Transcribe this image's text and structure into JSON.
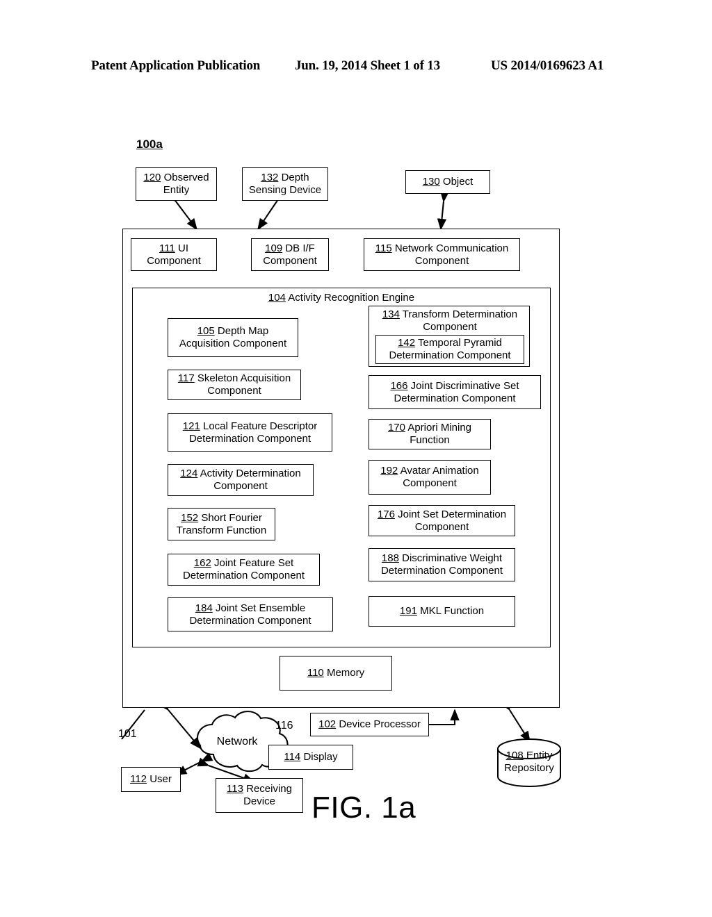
{
  "header": {
    "left": "Patent Application Publication",
    "middle": "Jun. 19, 2014  Sheet 1 of 13",
    "right": "US 2014/0169623 A1"
  },
  "figure": {
    "tag": "100a",
    "label": "FIG. 1a"
  },
  "top_boxes": [
    {
      "num": "120",
      "text": " Observed Entity"
    },
    {
      "num": "132",
      "text": " Depth Sensing Device"
    },
    {
      "num": "130",
      "text": " Object"
    }
  ],
  "interface_boxes": [
    {
      "num": "111",
      "text": " UI Component"
    },
    {
      "num": "109",
      "text": " DB I/F Component"
    },
    {
      "num": "115",
      "text": "  Network Communication Component"
    }
  ],
  "engine": {
    "num": "104",
    "title": " Activity Recognition Engine",
    "left_column": [
      {
        "num": "105",
        "text": " Depth Map Acquisition Component"
      },
      {
        "num": "117",
        "text": " Skeleton Acquisition Component"
      },
      {
        "num": "121",
        "text": " Local Feature Descriptor Determination Component"
      },
      {
        "num": "124",
        "text": " Activity Determination Component"
      },
      {
        "num": "152",
        "text": " Short Fourier Transform Function"
      },
      {
        "num": "162",
        "text": " Joint Feature Set Determination Component"
      },
      {
        "num": "184",
        "text": " Joint Set Ensemble Determination Component"
      }
    ],
    "right_column": [
      {
        "num": "134",
        "text": " Transform Determination Component",
        "nested": {
          "num": "142",
          "text": " Temporal Pyramid Determination Component"
        }
      },
      {
        "num": "166",
        "text": " Joint Discriminative Set Determination Component"
      },
      {
        "num": "170",
        "text": " Apriori Mining Function"
      },
      {
        "num": "192",
        "text": " Avatar Animation Component"
      },
      {
        "num": "176",
        "text": " Joint Set Determination Component"
      },
      {
        "num": "188",
        "text": " Discriminative Weight Determination Component"
      },
      {
        "num": "191",
        "text": " MKL Function"
      }
    ]
  },
  "memory": {
    "num": "110",
    "text": " Memory"
  },
  "peripherals": {
    "device_processor": {
      "num": "102",
      "text": " Device Processor"
    },
    "display": {
      "num": "114",
      "text": " Display"
    },
    "user": {
      "num": "112",
      "text": " User"
    },
    "receiving_device": {
      "num": "113",
      "text": " Receiving Device"
    },
    "entity_repository": {
      "num": "108",
      "line1": " Entity",
      "line2": "Repository"
    },
    "network_label": "Network",
    "lead_101": "101",
    "lead_116": "116"
  },
  "colors": {
    "ink": "#000000",
    "paper": "#ffffff"
  }
}
